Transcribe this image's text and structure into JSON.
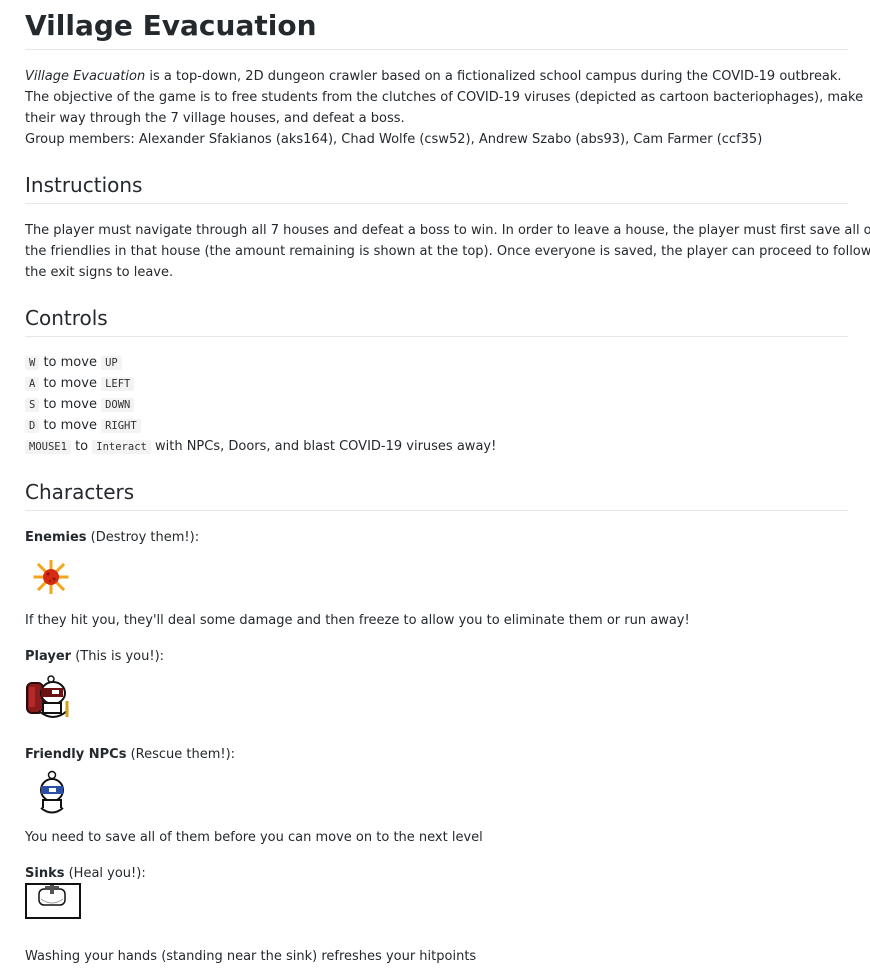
{
  "title": "Village Evacuation",
  "intro": {
    "game_name": "Village Evacuation",
    "line1_rest": " is a top-down, 2D dungeon crawler based on a fictionalized school campus during the COVID-19 outbreak.",
    "line2": "The objective of the game is to free students from the clutches of COVID-19 viruses (depicted as cartoon bacteriophages), make",
    "line3": "their way through the 7 village houses, and defeat a boss.",
    "line4": "Group members: Alexander Sfakianos (aks164), Chad Wolfe (csw52), Andrew Szabo (abs93), Cam Farmer (ccf35)"
  },
  "instructions": {
    "heading": "Instructions",
    "line1": "The player must navigate through all 7 houses and defeat a boss to win. In order to leave a house, the player must first save all of",
    "line2": "the friendlies in that house (the amount remaining is shown at the top). Once everyone is saved, the player can proceed to follow",
    "line3": "the exit signs to leave."
  },
  "controls": {
    "heading": "Controls",
    "rows": [
      {
        "key": "W",
        "mid": " to move ",
        "action": "UP",
        "tail": ""
      },
      {
        "key": "A",
        "mid": " to move ",
        "action": "LEFT",
        "tail": ""
      },
      {
        "key": "S",
        "mid": " to move ",
        "action": "DOWN",
        "tail": ""
      },
      {
        "key": "D",
        "mid": " to move ",
        "action": "RIGHT",
        "tail": ""
      },
      {
        "key": "MOUSE1",
        "mid": " to ",
        "action": "Interact",
        "tail": " with NPCs, Doors, and blast COVID-19 viruses away!"
      }
    ]
  },
  "characters": {
    "heading": "Characters",
    "enemies": {
      "name": "Enemies",
      "note": " (Destroy them!):",
      "desc": "If they hit you, they'll deal some damage and then freeze to allow you to eliminate them or run away!"
    },
    "player": {
      "name": "Player",
      "note": " (This is you!):"
    },
    "friendly": {
      "name": "Friendly NPCs",
      "note": " (Rescue them!):",
      "desc": "You need to save all of them before you can move on to the next level"
    },
    "sinks": {
      "name": "Sinks",
      "note": " (Heal you!):",
      "desc": "Washing your hands (standing near the sink) refreshes your hitpoints"
    }
  },
  "icons": {
    "enemy": "virus-icon",
    "player": "player-sprite-icon",
    "friendly": "friendly-npc-icon",
    "sink": "sink-icon"
  }
}
